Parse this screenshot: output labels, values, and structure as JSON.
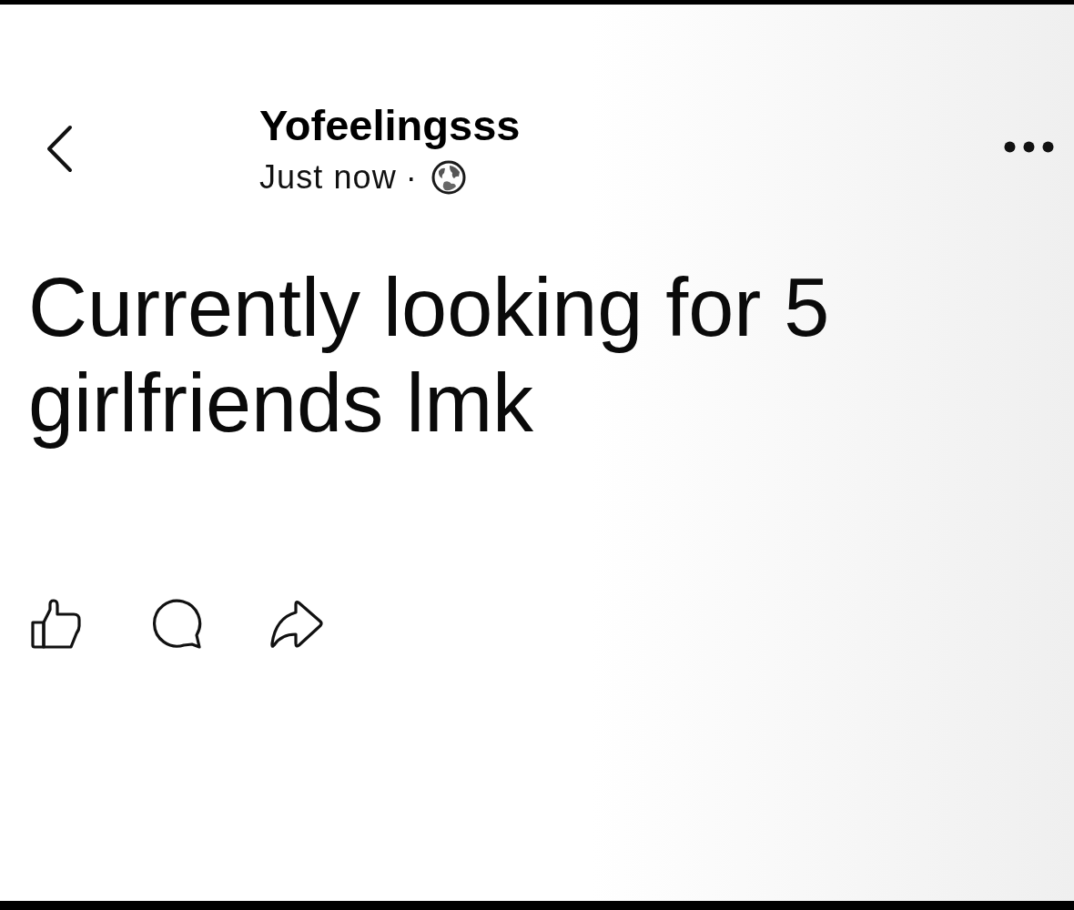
{
  "post": {
    "author": "Yofeelingsss",
    "time": "Just now",
    "separator": "·",
    "text": "Currently looking for 5 girlfriends lmk"
  }
}
